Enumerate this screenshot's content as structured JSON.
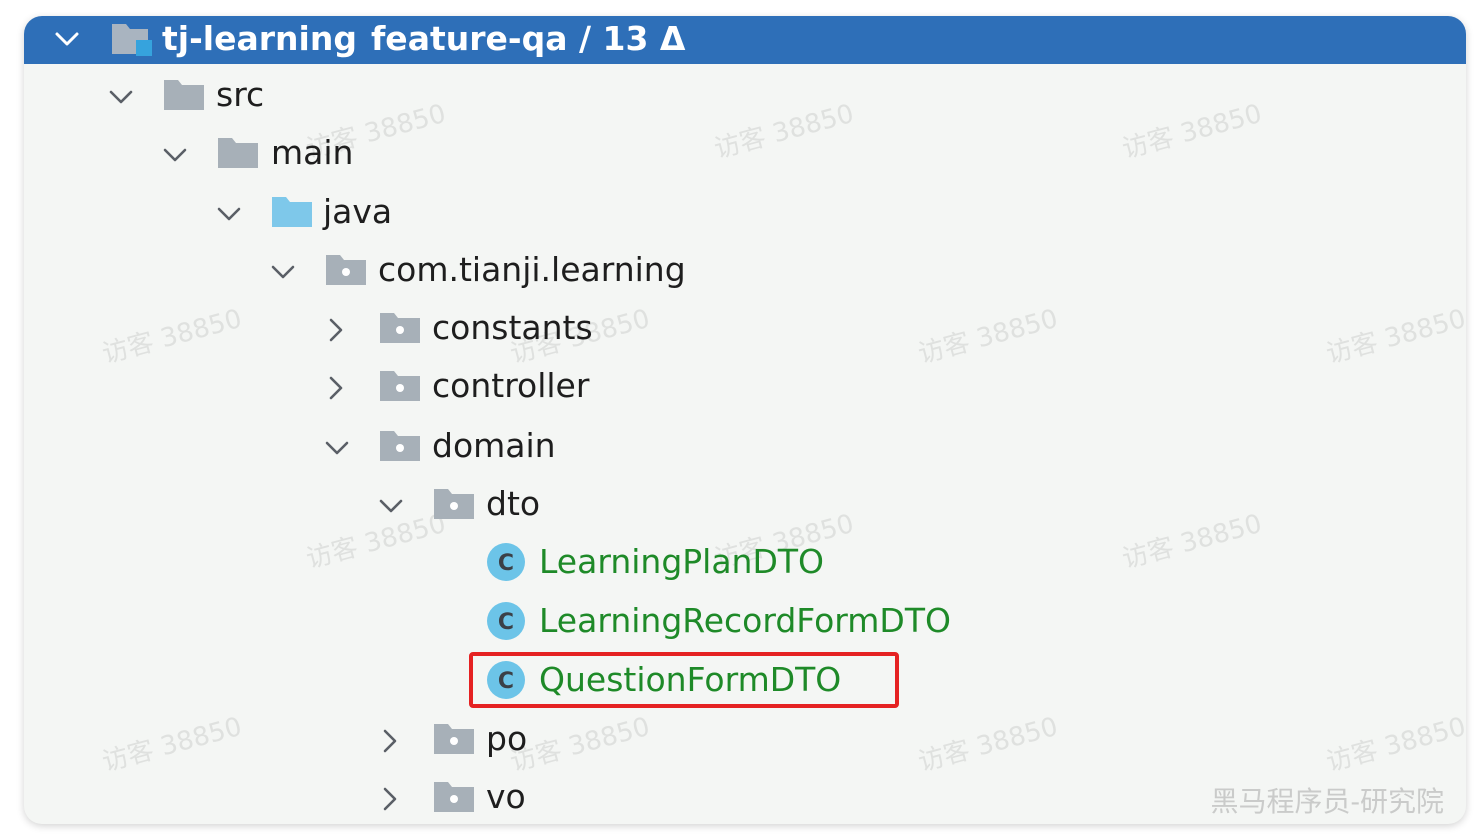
{
  "header": {
    "project_name": "tj-learning",
    "branch_info": "feature-qa / 13 Δ"
  },
  "tree": {
    "src": "src",
    "main": "main",
    "java": "java",
    "package": "com.tianji.learning",
    "constants": "constants",
    "controller": "controller",
    "domain": "domain",
    "dto": "dto",
    "class_1": "LearningPlanDTO",
    "class_2": "LearningRecordFormDTO",
    "class_3": "QuestionFormDTO",
    "po": "po",
    "vo": "vo",
    "class_badge": "C"
  },
  "watermarks": {
    "visitor": "访客 38850",
    "footer": "黑马程序员-研究院"
  },
  "colors": {
    "header_bg": "#2e6fb8",
    "class_name": "#1e8a28",
    "highlight": "#e52222",
    "folder": "#a7b0b8",
    "source_folder": "#7ec8ea",
    "class_badge": "#6cc4e8"
  },
  "icons": {
    "expanded": "chevron-down-icon",
    "collapsed": "chevron-right-icon",
    "folder": "folder-icon",
    "package": "package-icon",
    "source_root": "source-root-folder-icon",
    "class": "java-class-icon"
  }
}
